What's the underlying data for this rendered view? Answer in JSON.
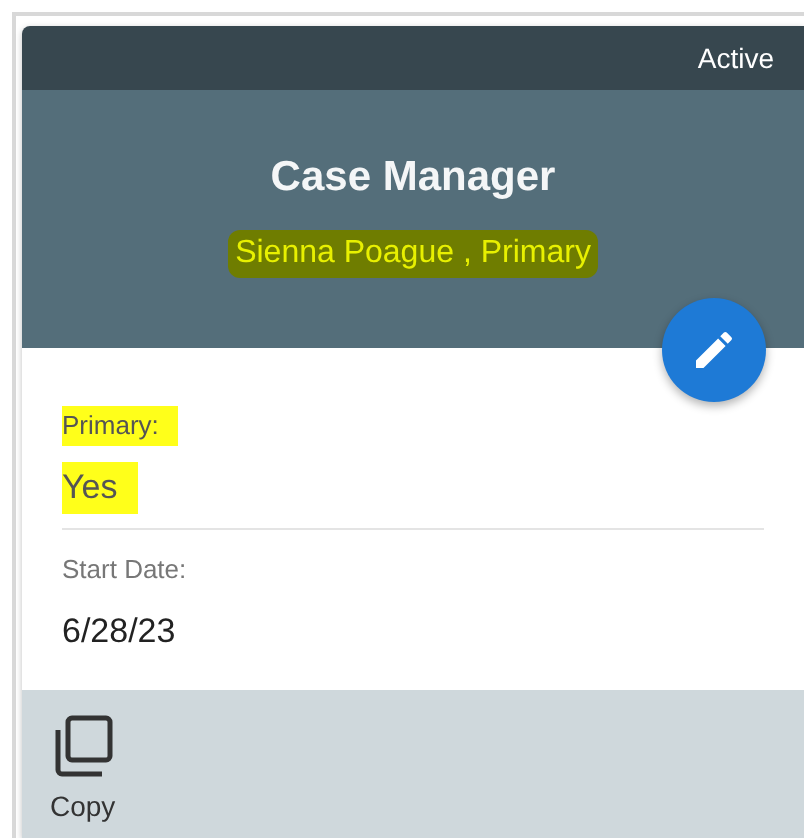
{
  "status": "Active",
  "header": {
    "title": "Case Manager",
    "subtitle": "Sienna Poague , Primary",
    "subtitle_highlighted": true
  },
  "fields": [
    {
      "label": "Primary:",
      "value": "Yes",
      "highlighted": true
    },
    {
      "label": "Start Date:",
      "value": "6/28/23",
      "highlighted": false
    }
  ],
  "actions": [
    {
      "label": "Copy"
    }
  ]
}
